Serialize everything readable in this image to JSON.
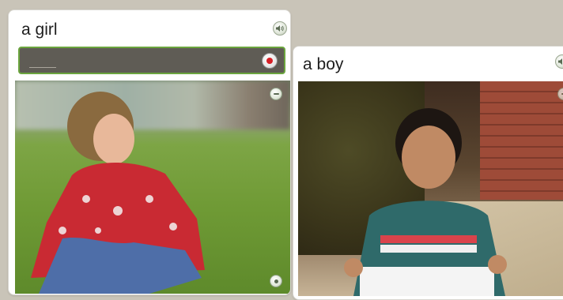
{
  "cards": [
    {
      "id": "girl",
      "title": "a girl",
      "speaker_icon": "speaker-icon",
      "record_icon": "record-icon",
      "photo_label": "girl-photo",
      "photo_icons": [
        "expand-icon",
        "corner-icon"
      ]
    },
    {
      "id": "boy",
      "title": "a boy",
      "speaker_icon": "speaker-icon",
      "photo_label": "boy-photo",
      "photo_icons": [
        "expand-icon"
      ]
    }
  ],
  "colors": {
    "background": "#c9c4b8",
    "record_border": "#6ba53e",
    "record_bar": "#5f5c55",
    "record_dot": "#d61f26"
  }
}
